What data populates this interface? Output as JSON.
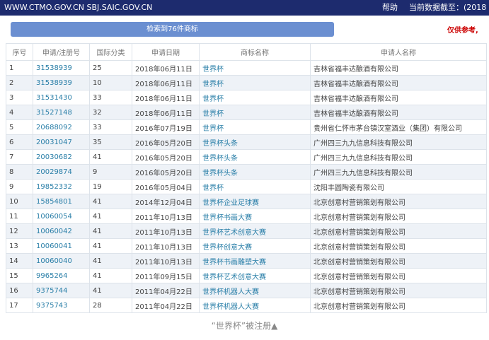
{
  "header": {
    "site": "WWW.CTMO.GOV.CN SBJ.SAIC.GOV.CN",
    "help": "帮助",
    "data_as_of": "当前数据截至：(2018"
  },
  "search_result_button": "检索到76件商标",
  "notice": "仅供参考,",
  "columns": [
    "序号",
    "申请/注册号",
    "国际分类",
    "申请日期",
    "商标名称",
    "申请人名称"
  ],
  "rows": [
    [
      "1",
      "31538939",
      "25",
      "2018年06月11日",
      "世界杯",
      "吉林省福丰达酿酒有限公司"
    ],
    [
      "2",
      "31538939",
      "10",
      "2018年06月11日",
      "世界杯",
      "吉林省福丰达酿酒有限公司"
    ],
    [
      "3",
      "31531430",
      "33",
      "2018年06月11日",
      "世界杯",
      "吉林省福丰达酿酒有限公司"
    ],
    [
      "4",
      "31527148",
      "32",
      "2018年06月11日",
      "世界杯",
      "吉林省福丰达酿酒有限公司"
    ],
    [
      "5",
      "20688092",
      "33",
      "2016年07月19日",
      "世界杯",
      "贵州省仁怀市茅台镇汉室酒业（集团）有限公司"
    ],
    [
      "6",
      "20031047",
      "35",
      "2016年05月20日",
      "世界杯头条",
      "广州四三九九信息科技有限公司"
    ],
    [
      "7",
      "20030682",
      "41",
      "2016年05月20日",
      "世界杯头条",
      "广州四三九九信息科技有限公司"
    ],
    [
      "8",
      "20029874",
      "9",
      "2016年05月20日",
      "世界杯头条",
      "广州四三九九信息科技有限公司"
    ],
    [
      "9",
      "19852332",
      "19",
      "2016年05月04日",
      "世界杯",
      "沈阳丰圆陶瓷有限公司"
    ],
    [
      "10",
      "15854801",
      "41",
      "2014年12月04日",
      "世界杯企业足球赛",
      "北京创意村营销策划有限公司"
    ],
    [
      "11",
      "10060054",
      "41",
      "2011年10月13日",
      "世界杯书画大赛",
      "北京创意村营销策划有限公司"
    ],
    [
      "12",
      "10060042",
      "41",
      "2011年10月13日",
      "世界杯艺术创意大赛",
      "北京创意村营销策划有限公司"
    ],
    [
      "13",
      "10060041",
      "41",
      "2011年10月13日",
      "世界杯创意大赛",
      "北京创意村营销策划有限公司"
    ],
    [
      "14",
      "10060040",
      "41",
      "2011年10月13日",
      "世界杯书画雕塑大赛",
      "北京创意村营销策划有限公司"
    ],
    [
      "15",
      "9965264",
      "41",
      "2011年09月15日",
      "世界杯艺术创意大赛",
      "北京创意村营销策划有限公司"
    ],
    [
      "16",
      "9375744",
      "41",
      "2011年04月22日",
      "世界杯机器人大赛",
      "北京创意村营销策划有限公司"
    ],
    [
      "17",
      "9375743",
      "28",
      "2011年04月22日",
      "世界杯机器人大赛",
      "北京创意村营销策划有限公司"
    ]
  ],
  "caption": "“世界杯”被注册▲"
}
